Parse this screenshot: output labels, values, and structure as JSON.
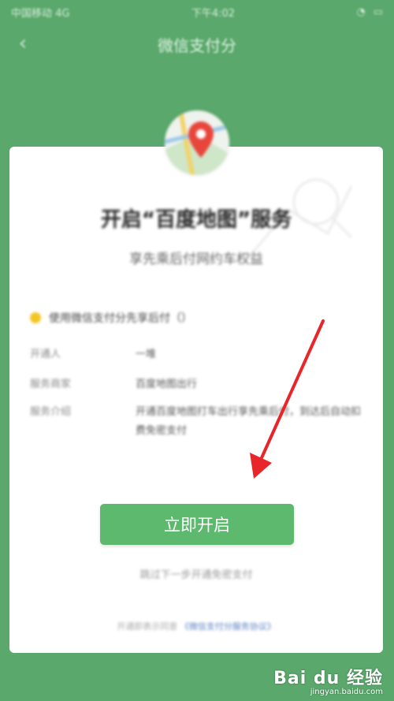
{
  "status_bar": {
    "time": "下午4:02",
    "left": "中国移动 4G"
  },
  "header": {
    "title": "微信支付分",
    "back_icon": "chevron-left-icon"
  },
  "card": {
    "title": "开启“百度地图”服务",
    "subtitle": "享先乘后付网约车权益",
    "notice": "使用微信支付分先享后付（）",
    "rows": [
      {
        "key": "开通人",
        "value": "一堆"
      },
      {
        "key": "服务商家",
        "value": "百度地图出行"
      },
      {
        "key": "服务介绍",
        "value": "开通百度地图打车出行享先乘后付，到达后自动扣费免密支付"
      }
    ],
    "primary_button": "立即开启",
    "secondary_link": "跳过下一步开通免密支付",
    "footer_text": "开通即表示同意",
    "footer_link": "《微信支付分服务协议》"
  },
  "watermark": {
    "main": "Bai du 经验",
    "sub": "jingyan.baidu.com"
  },
  "colors": {
    "brand_green": "#5aa86c",
    "button_green": "#5db96e",
    "arrow_red": "#e8262a"
  }
}
